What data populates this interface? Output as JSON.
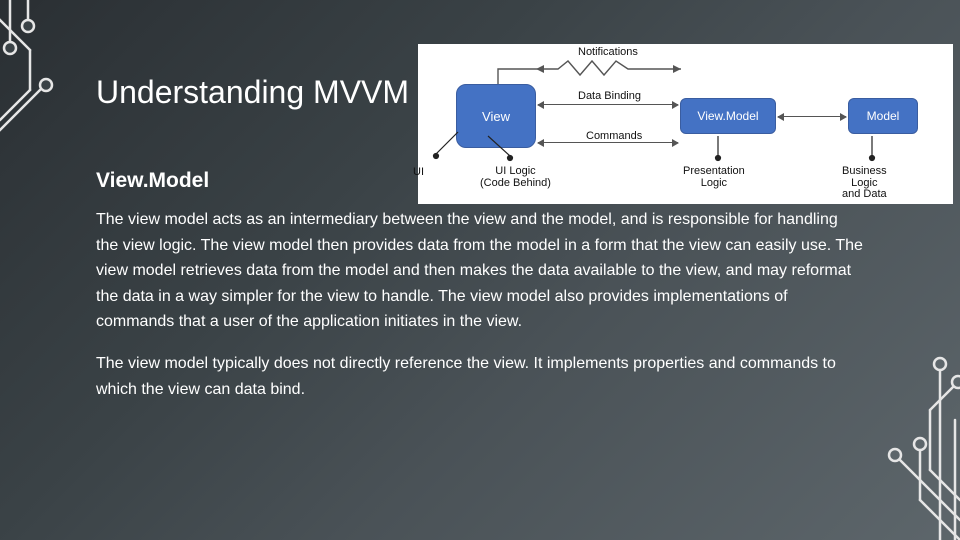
{
  "title": "Understanding MVVM",
  "subtitle": "View.Model",
  "paragraphs": [
    "The view model acts as an intermediary between the view and the model, and is responsible for handling the view logic. The view model then provides data from the model in a form that the view can easily use. The view model retrieves data from the model and then makes the data available to the view, and may reformat the data in a way simpler for the view to handle. The view model also provides implementations of commands that a user of the application initiates in the view.",
    "The view model typically does not directly reference the view. It implements properties and commands to which the view can data bind."
  ],
  "diagram": {
    "view_box_label": "View",
    "viewmodel_box_label": "View.Model",
    "model_box_label": "Model",
    "notifications_label": "Notifications",
    "databinding_label": "Data Binding",
    "commands_label": "Commands",
    "ui_label": "UI",
    "uilogic_label_line1": "UI Logic",
    "uilogic_label_line2": "(Code Behind)",
    "presentation_label_line1": "Presentation",
    "presentation_label_line2": "Logic",
    "business_label_line1": "Business",
    "business_label_line2": "Logic",
    "business_label_line3": "and Data"
  }
}
